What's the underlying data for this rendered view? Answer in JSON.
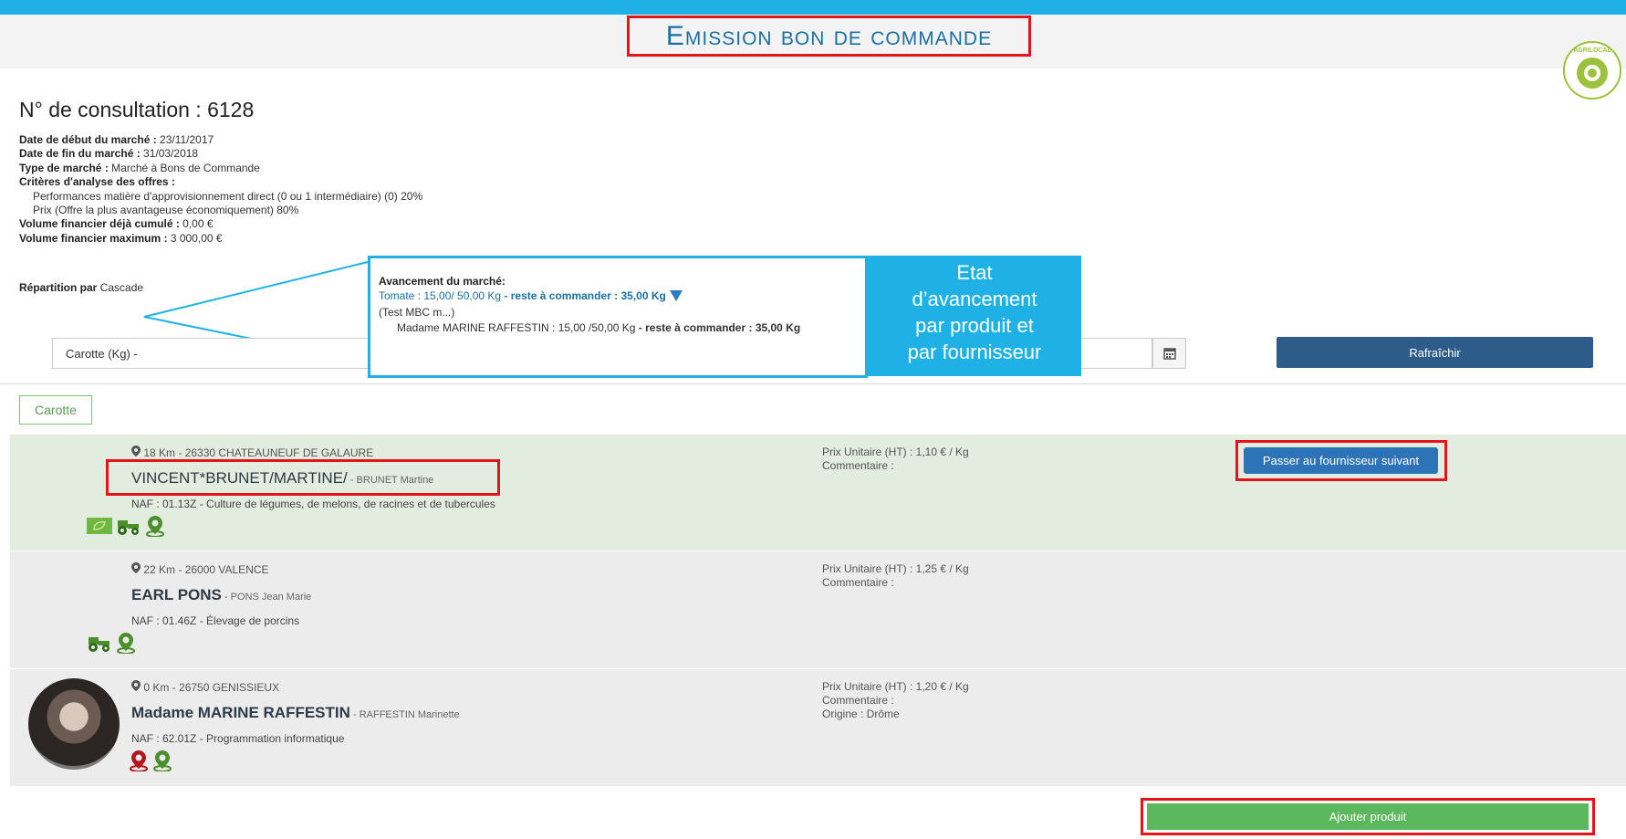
{
  "header": {
    "title": "Emission bon de commande",
    "logo_text": "AGRILOCAL"
  },
  "consultation": {
    "title": "N° de consultation : 6128",
    "date_debut_label": "Date de début du marché : ",
    "date_debut": "23/11/2017",
    "date_fin_label": "Date de fin du marché : ",
    "date_fin": "31/03/2018",
    "type_label": "Type de marché : ",
    "type": "Marché à Bons de Commande",
    "criteres_label": "Critères d'analyse des offres :",
    "criteres": [
      "Performances matière d'approvisionnement direct (0 ou 1 intermédiaire) (0) 20%",
      "Prix (Offre la plus avantageuse économiquement) 80%"
    ],
    "volume_cumule_label": "Volume financier déjà cumulé : ",
    "volume_cumule": "0,00 €",
    "volume_max_label": "Volume financier maximum : ",
    "volume_max": "3 000,00 €",
    "repartition_label": "Répartition par ",
    "repartition": "Cascade"
  },
  "popup": {
    "header": "Avancement du marché:",
    "product_line": "Tomate   : 15,00/ 50,00 Kg",
    "product_remaining": " - reste à commander : 35,00 Kg",
    "test_line": "(Test MBC m...)",
    "supplier_line": "Madame MARINE RAFFESTIN : 15,00 /50,00 Kg",
    "supplier_remaining": "  - reste à commander : 35,00  Kg"
  },
  "callout": {
    "lines": [
      "Etat",
      "d’avancement",
      "par produit et",
      "par fournisseur"
    ]
  },
  "filters": {
    "product_value": "Carotte (Kg) -",
    "refresh_label": "Rafraîchir"
  },
  "tabs": [
    {
      "label": "Carotte"
    }
  ],
  "suppliers": [
    {
      "location": "18 Km  -  26330 CHATEAUNEUF DE GALAURE",
      "name": "VINCENT*BRUNET/MARTINE/",
      "contact": " - BRUNET Martine",
      "naf": "NAF : 01.13Z - Culture de légumes, de melons, de racines et de tubercules",
      "price": "Prix Unitaire (HT) : 1,10 € / Kg",
      "comment": "Commentaire :",
      "icons": [
        "bio-icon",
        "tractor-icon",
        "map-pin-icon"
      ],
      "action_label": "Passer au fournisseur suivant"
    },
    {
      "location": "22 Km  -  26000 VALENCE",
      "name": "EARL PONS",
      "contact": " - PONS Jean Marie",
      "naf": "NAF : 01.46Z - Élevage de porcins",
      "price": "Prix Unitaire (HT) : 1,25 € / Kg",
      "comment": "Commentaire :",
      "icons": [
        "tractor-icon",
        "map-pin-icon"
      ]
    },
    {
      "location": "0 Km  -  26750 GENISSIEUX",
      "name": "Madame MARINE RAFFESTIN",
      "contact": " - RAFFESTIN Marinette",
      "naf": "NAF : 62.01Z - Programmation informatique",
      "price": "Prix Unitaire (HT) : 1,20 € / Kg",
      "comment": "Commentaire :",
      "origin": "Origine : Drôme",
      "icons": [
        "red-map-pin-icon",
        "map-pin-icon"
      ]
    }
  ],
  "footer": {
    "add_label": "Ajouter produit"
  },
  "colors": {
    "topbar": "#1fb1e6",
    "title": "#1c6fa3",
    "highlight_border": "#e4141b",
    "refresh": "#2e5c8a",
    "add_button": "#5cb85c",
    "selected_row": "#e2ecdf"
  }
}
